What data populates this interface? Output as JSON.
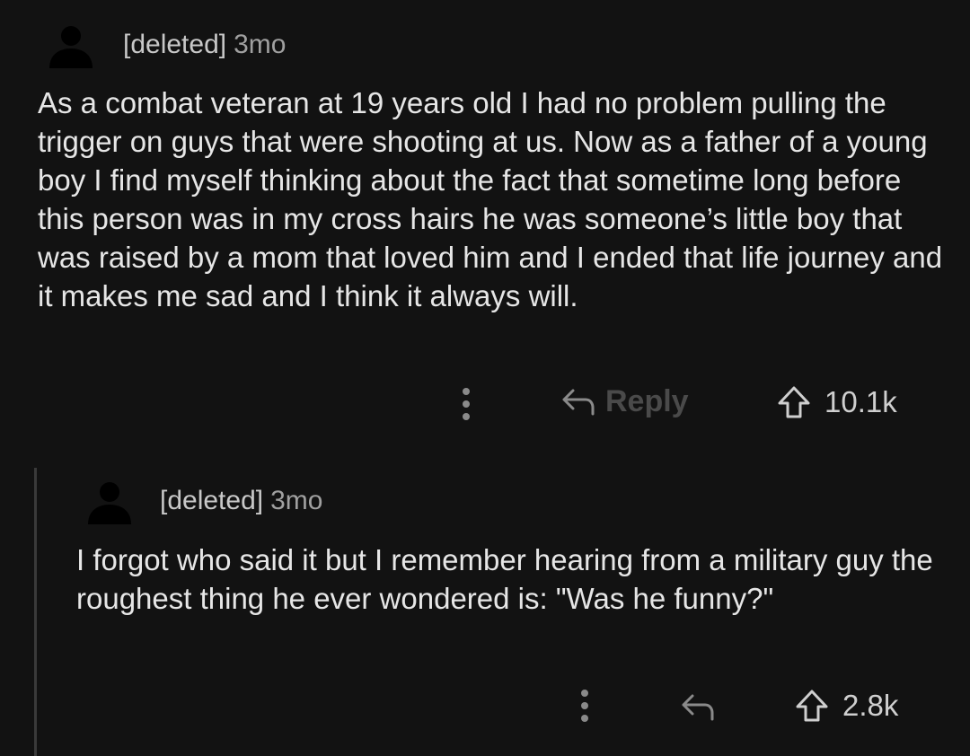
{
  "comments": [
    {
      "author": "[deleted]",
      "age": "3mo",
      "body": "As a combat veteran at 19 years old I had no problem pulling the trigger on guys that were shooting at us.  Now as a father of a young boy I find myself thinking about the fact that sometime long before this person was in my cross hairs he was someone’s little boy that was raised by a mom that loved him and I ended that life journey and it makes me sad and I think it always will.",
      "reply_label": "Reply",
      "votes": "10.1k"
    },
    {
      "author": "[deleted]",
      "age": "3mo",
      "body": "I forgot who said it but I remember hearing from a military guy the roughest thing he ever wondered is: \"Was he funny?\"",
      "votes": "2.8k"
    }
  ],
  "icons": {
    "avatar": "user-silhouette-icon",
    "more": "more-vertical-icon",
    "reply": "reply-arrow-icon",
    "upvote": "upvote-arrow-icon"
  },
  "colors": {
    "background": "#121212",
    "text": "#e6e6e6",
    "muted": "#8a8a8a",
    "thread_line": "#3a3a3a"
  }
}
